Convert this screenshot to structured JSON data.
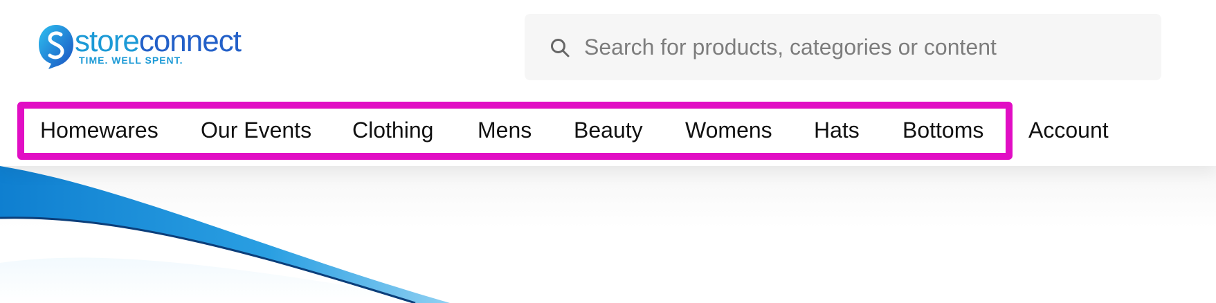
{
  "logo": {
    "word_part1": "store",
    "word_part2": "connect",
    "tagline": "TIME. WELL SPENT.",
    "colors": {
      "primary": "#1c9ad6",
      "secondary": "#2360c8"
    }
  },
  "search": {
    "placeholder": "Search for products, categories or content",
    "value": ""
  },
  "nav": {
    "items": [
      {
        "label": "Homewares"
      },
      {
        "label": "Our Events"
      },
      {
        "label": "Clothing"
      },
      {
        "label": "Mens"
      },
      {
        "label": "Beauty"
      },
      {
        "label": "Womens"
      },
      {
        "label": "Hats"
      },
      {
        "label": "Bottoms"
      },
      {
        "label": "Account"
      }
    ],
    "highlight_color": "#e10ec4"
  },
  "hero": {
    "accent_color": "#1b8fd8"
  }
}
